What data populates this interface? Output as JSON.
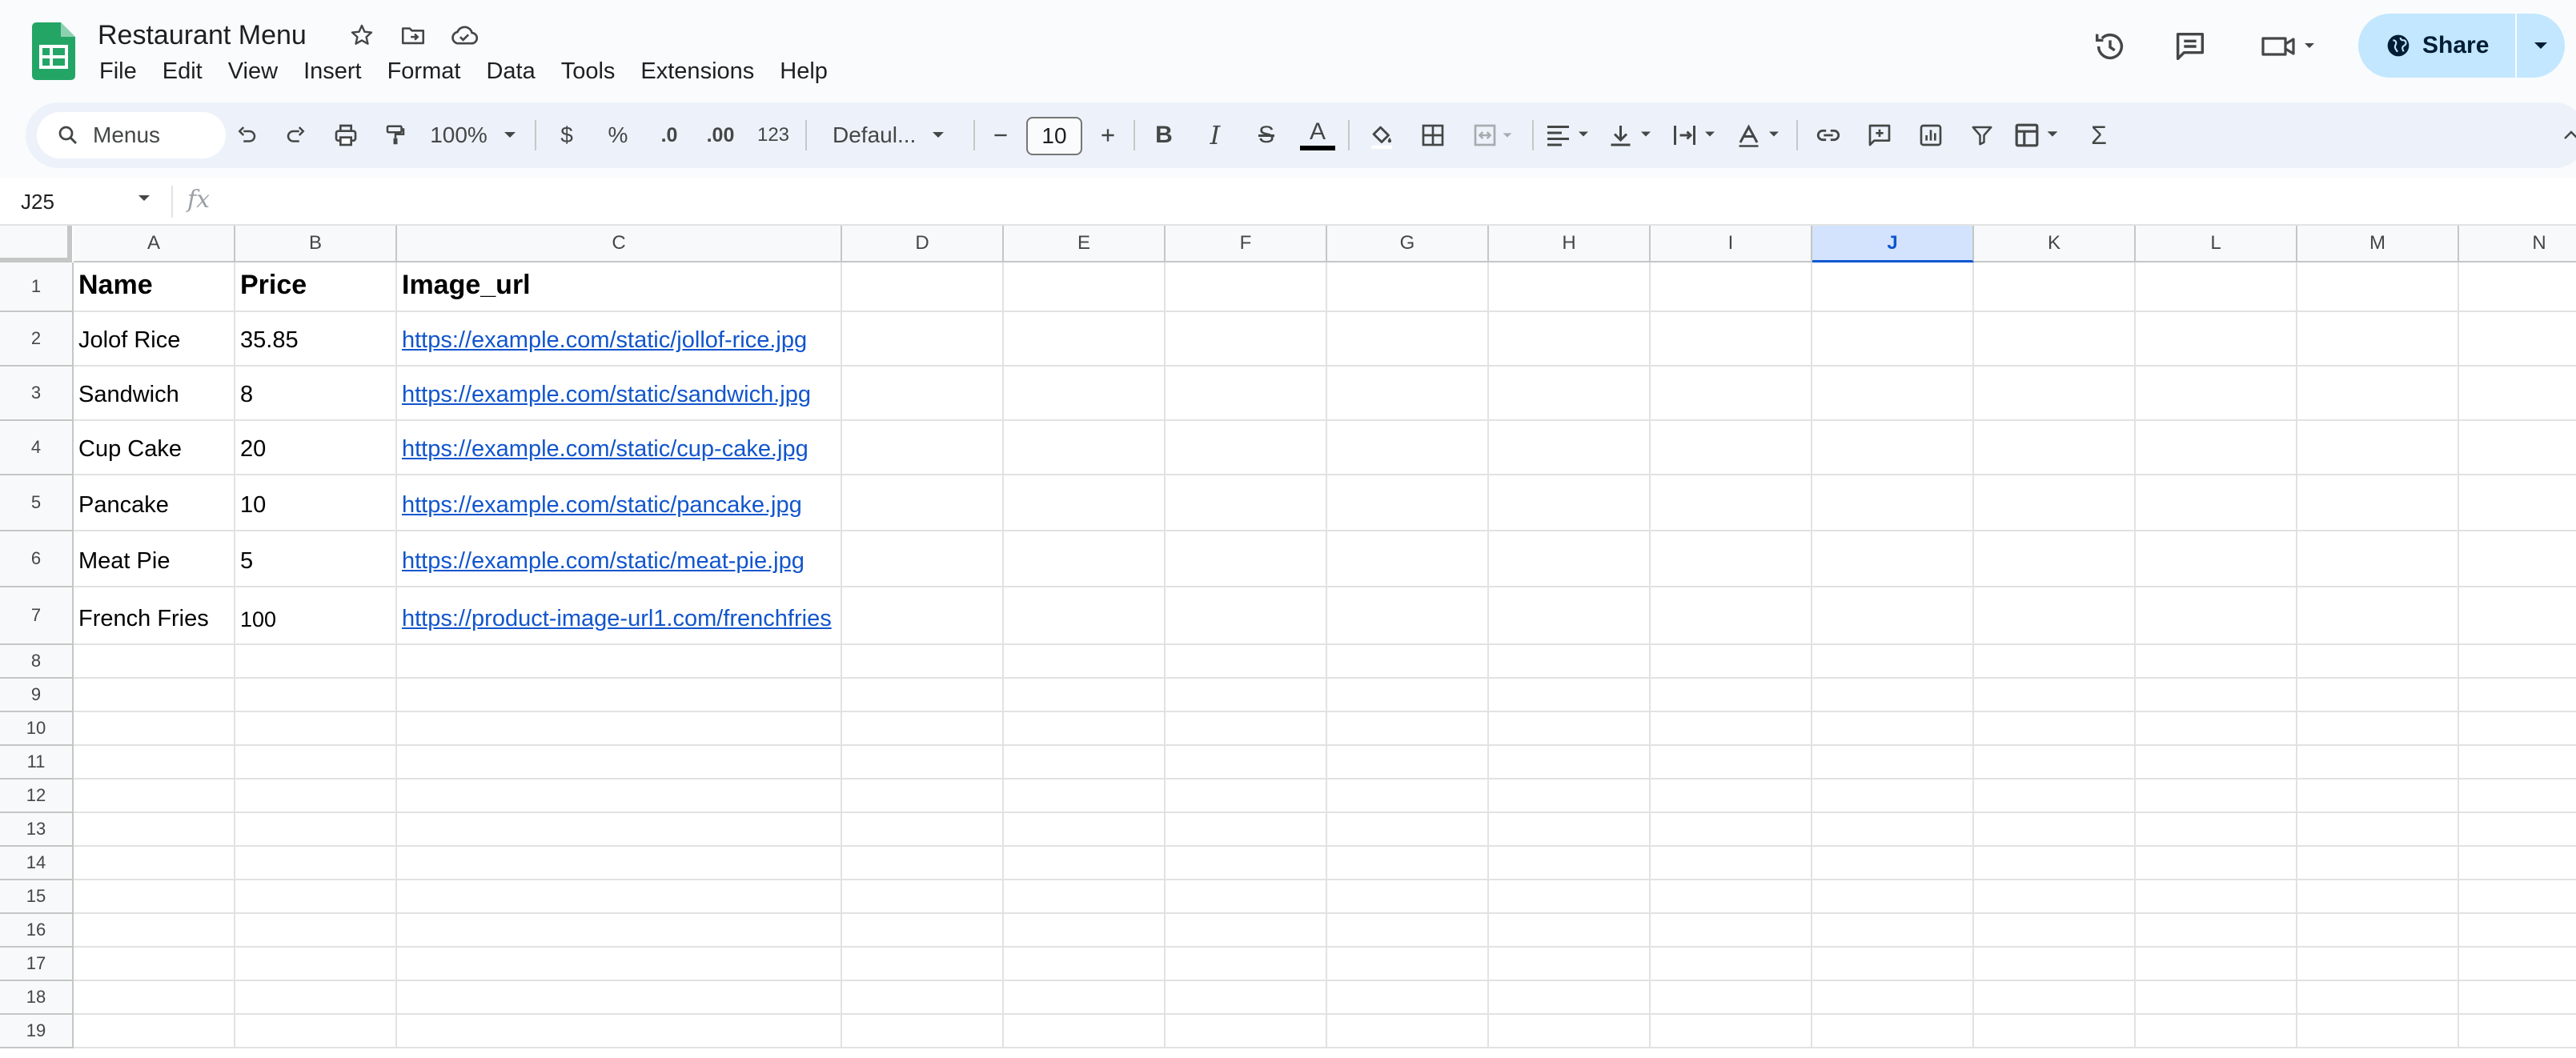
{
  "app": {
    "doc_title": "Restaurant Menu",
    "menu": [
      "File",
      "Edit",
      "View",
      "Insert",
      "Format",
      "Data",
      "Tools",
      "Extensions",
      "Help"
    ],
    "share_label": "Share"
  },
  "toolbar": {
    "search_label": "Menus",
    "zoom": "100%",
    "currency": "$",
    "percent": "%",
    "decrease_decimal": ".0",
    "increase_decimal": ".00",
    "number_format": "123",
    "font": "Defaul...",
    "font_size": "10"
  },
  "formula_bar": {
    "name_box": "J25",
    "fx": "fx",
    "value": ""
  },
  "sheet": {
    "columns": [
      "A",
      "B",
      "C",
      "D",
      "E",
      "F",
      "G",
      "H",
      "I",
      "J",
      "K",
      "L",
      "M",
      "N"
    ],
    "selected_column": "J",
    "row_numbers": [
      "1",
      "2",
      "3",
      "4",
      "5",
      "6",
      "7",
      "8",
      "9",
      "10",
      "11",
      "12",
      "13",
      "14",
      "15",
      "16",
      "17",
      "18",
      "19"
    ],
    "rows": [
      [
        "Name",
        "Price",
        "Image_url"
      ],
      [
        "Jolof Rice",
        "35.85",
        "https://example.com/static/jollof-rice.jpg"
      ],
      [
        "Sandwich",
        "8",
        "https://example.com/static/sandwich.jpg"
      ],
      [
        "Cup Cake",
        "20",
        "https://example.com/static/cup-cake.jpg"
      ],
      [
        "Pancake",
        "10",
        "https://example.com/static/pancake.jpg"
      ],
      [
        "Meat Pie",
        "5",
        "https://example.com/static/meat-pie.jpg"
      ],
      [
        "French Fries",
        "100",
        "https://product-image-url1.com/frenchfries"
      ]
    ]
  }
}
